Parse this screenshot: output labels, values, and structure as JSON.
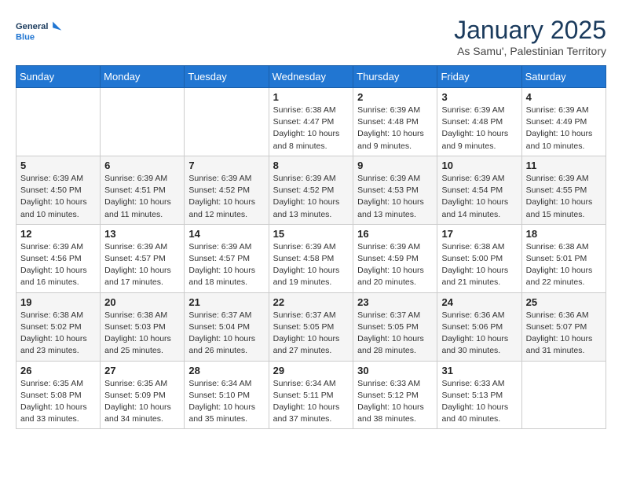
{
  "header": {
    "logo_line1": "General",
    "logo_line2": "Blue",
    "month_title": "January 2025",
    "subtitle": "As Samu', Palestinian Territory"
  },
  "weekdays": [
    "Sunday",
    "Monday",
    "Tuesday",
    "Wednesday",
    "Thursday",
    "Friday",
    "Saturday"
  ],
  "weeks": [
    [
      {
        "day": "",
        "info": ""
      },
      {
        "day": "",
        "info": ""
      },
      {
        "day": "",
        "info": ""
      },
      {
        "day": "1",
        "info": "Sunrise: 6:38 AM\nSunset: 4:47 PM\nDaylight: 10 hours\nand 8 minutes."
      },
      {
        "day": "2",
        "info": "Sunrise: 6:39 AM\nSunset: 4:48 PM\nDaylight: 10 hours\nand 9 minutes."
      },
      {
        "day": "3",
        "info": "Sunrise: 6:39 AM\nSunset: 4:48 PM\nDaylight: 10 hours\nand 9 minutes."
      },
      {
        "day": "4",
        "info": "Sunrise: 6:39 AM\nSunset: 4:49 PM\nDaylight: 10 hours\nand 10 minutes."
      }
    ],
    [
      {
        "day": "5",
        "info": "Sunrise: 6:39 AM\nSunset: 4:50 PM\nDaylight: 10 hours\nand 10 minutes."
      },
      {
        "day": "6",
        "info": "Sunrise: 6:39 AM\nSunset: 4:51 PM\nDaylight: 10 hours\nand 11 minutes."
      },
      {
        "day": "7",
        "info": "Sunrise: 6:39 AM\nSunset: 4:52 PM\nDaylight: 10 hours\nand 12 minutes."
      },
      {
        "day": "8",
        "info": "Sunrise: 6:39 AM\nSunset: 4:52 PM\nDaylight: 10 hours\nand 13 minutes."
      },
      {
        "day": "9",
        "info": "Sunrise: 6:39 AM\nSunset: 4:53 PM\nDaylight: 10 hours\nand 13 minutes."
      },
      {
        "day": "10",
        "info": "Sunrise: 6:39 AM\nSunset: 4:54 PM\nDaylight: 10 hours\nand 14 minutes."
      },
      {
        "day": "11",
        "info": "Sunrise: 6:39 AM\nSunset: 4:55 PM\nDaylight: 10 hours\nand 15 minutes."
      }
    ],
    [
      {
        "day": "12",
        "info": "Sunrise: 6:39 AM\nSunset: 4:56 PM\nDaylight: 10 hours\nand 16 minutes."
      },
      {
        "day": "13",
        "info": "Sunrise: 6:39 AM\nSunset: 4:57 PM\nDaylight: 10 hours\nand 17 minutes."
      },
      {
        "day": "14",
        "info": "Sunrise: 6:39 AM\nSunset: 4:57 PM\nDaylight: 10 hours\nand 18 minutes."
      },
      {
        "day": "15",
        "info": "Sunrise: 6:39 AM\nSunset: 4:58 PM\nDaylight: 10 hours\nand 19 minutes."
      },
      {
        "day": "16",
        "info": "Sunrise: 6:39 AM\nSunset: 4:59 PM\nDaylight: 10 hours\nand 20 minutes."
      },
      {
        "day": "17",
        "info": "Sunrise: 6:38 AM\nSunset: 5:00 PM\nDaylight: 10 hours\nand 21 minutes."
      },
      {
        "day": "18",
        "info": "Sunrise: 6:38 AM\nSunset: 5:01 PM\nDaylight: 10 hours\nand 22 minutes."
      }
    ],
    [
      {
        "day": "19",
        "info": "Sunrise: 6:38 AM\nSunset: 5:02 PM\nDaylight: 10 hours\nand 23 minutes."
      },
      {
        "day": "20",
        "info": "Sunrise: 6:38 AM\nSunset: 5:03 PM\nDaylight: 10 hours\nand 25 minutes."
      },
      {
        "day": "21",
        "info": "Sunrise: 6:37 AM\nSunset: 5:04 PM\nDaylight: 10 hours\nand 26 minutes."
      },
      {
        "day": "22",
        "info": "Sunrise: 6:37 AM\nSunset: 5:05 PM\nDaylight: 10 hours\nand 27 minutes."
      },
      {
        "day": "23",
        "info": "Sunrise: 6:37 AM\nSunset: 5:05 PM\nDaylight: 10 hours\nand 28 minutes."
      },
      {
        "day": "24",
        "info": "Sunrise: 6:36 AM\nSunset: 5:06 PM\nDaylight: 10 hours\nand 30 minutes."
      },
      {
        "day": "25",
        "info": "Sunrise: 6:36 AM\nSunset: 5:07 PM\nDaylight: 10 hours\nand 31 minutes."
      }
    ],
    [
      {
        "day": "26",
        "info": "Sunrise: 6:35 AM\nSunset: 5:08 PM\nDaylight: 10 hours\nand 33 minutes."
      },
      {
        "day": "27",
        "info": "Sunrise: 6:35 AM\nSunset: 5:09 PM\nDaylight: 10 hours\nand 34 minutes."
      },
      {
        "day": "28",
        "info": "Sunrise: 6:34 AM\nSunset: 5:10 PM\nDaylight: 10 hours\nand 35 minutes."
      },
      {
        "day": "29",
        "info": "Sunrise: 6:34 AM\nSunset: 5:11 PM\nDaylight: 10 hours\nand 37 minutes."
      },
      {
        "day": "30",
        "info": "Sunrise: 6:33 AM\nSunset: 5:12 PM\nDaylight: 10 hours\nand 38 minutes."
      },
      {
        "day": "31",
        "info": "Sunrise: 6:33 AM\nSunset: 5:13 PM\nDaylight: 10 hours\nand 40 minutes."
      },
      {
        "day": "",
        "info": ""
      }
    ]
  ]
}
